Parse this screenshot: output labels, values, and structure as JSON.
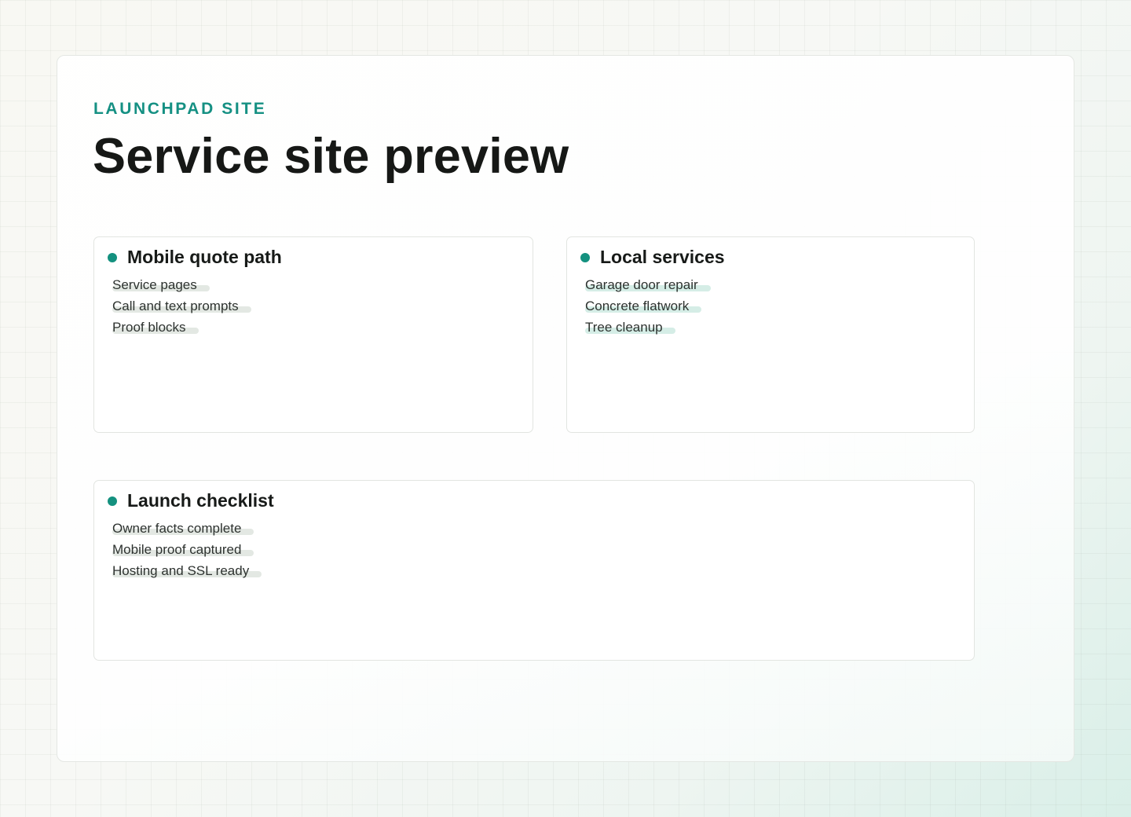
{
  "header": {
    "eyebrow": "LAUNCHPAD SITE",
    "title": "Service site preview"
  },
  "cards": [
    {
      "title": "Mobile quote path",
      "items": [
        "Service pages",
        "Call and text prompts",
        "Proof blocks"
      ]
    },
    {
      "title": "Local services",
      "items": [
        "Garage door repair",
        "Concrete flatwork",
        "Tree cleanup"
      ]
    },
    {
      "title": "Launch checklist",
      "items": [
        "Owner facts complete",
        "Mobile proof captured",
        "Hosting and SSL ready"
      ]
    }
  ],
  "colors": {
    "accent": "#14917f",
    "eyebrow": "#159083",
    "title": "#161816"
  }
}
